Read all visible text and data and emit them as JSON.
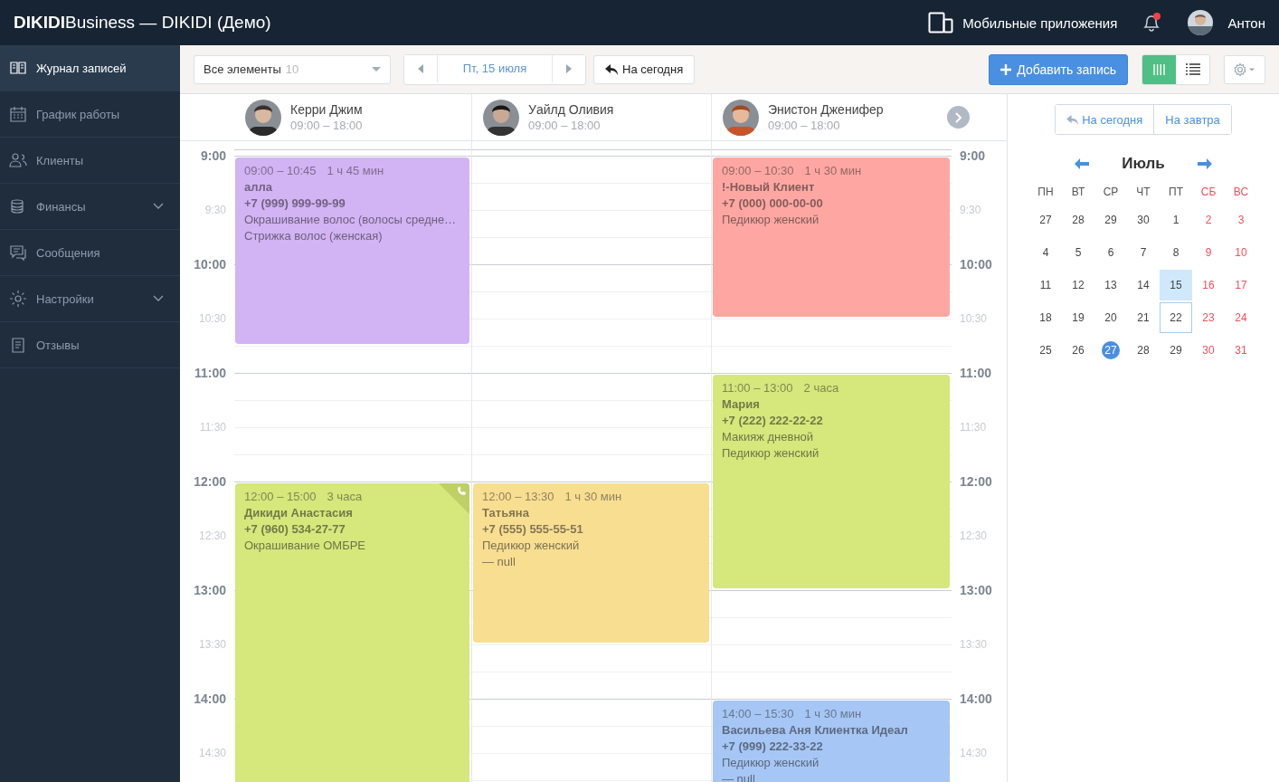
{
  "topbar": {
    "title": "**DIKIDI**Business —  DIKIDI (Демо)",
    "apps_link": "Мобильные приложения",
    "notifications": {
      "unread": true
    },
    "user": {
      "name": "Антон"
    }
  },
  "sidebar": {
    "items": [
      {
        "label": "Журнал записей",
        "selected": true,
        "submenu": false
      },
      {
        "label": "График работы",
        "selected": false,
        "submenu": false
      },
      {
        "label": "Клиенты",
        "selected": false,
        "submenu": false
      },
      {
        "label": "Финансы",
        "selected": false,
        "submenu": true
      },
      {
        "label": "Сообщения",
        "selected": false,
        "submenu": false
      },
      {
        "label": "Настройки",
        "selected": false,
        "submenu": true
      },
      {
        "label": "Отзывы",
        "selected": false,
        "submenu": false
      }
    ]
  },
  "toolbar": {
    "filter": {
      "label": "Все элементы",
      "count": "10"
    },
    "date": "Пт, 15 июля",
    "today_button": "На сегодня",
    "add_button": "Добавить запись",
    "views": [
      {
        "kind": "columns",
        "selected": true
      },
      {
        "kind": "list",
        "selected": false
      }
    ]
  },
  "time_rows": [
    {
      "kind": "hour",
      "left": "9:00",
      "right": "9:00"
    },
    {
      "kind": "half",
      "left": "9:30",
      "right": "9:30"
    },
    {
      "kind": "hour",
      "left": "10:00",
      "right": "10:00"
    },
    {
      "kind": "half",
      "left": "10:30",
      "right": "10:30"
    },
    {
      "kind": "hour",
      "left": "11:00",
      "right": "11:00"
    },
    {
      "kind": "half",
      "left": "11:30",
      "right": "11:30"
    },
    {
      "kind": "hour",
      "left": "12:00",
      "right": "12:00"
    },
    {
      "kind": "half",
      "left": "12:30",
      "right": "12:30"
    },
    {
      "kind": "hour",
      "left": "13:00",
      "right": "13:00"
    },
    {
      "kind": "half",
      "left": "13:30",
      "right": "13:30"
    },
    {
      "kind": "hour",
      "left": "14:00",
      "right": "14:00"
    },
    {
      "kind": "half",
      "left": "14:30",
      "right": "14:30"
    }
  ],
  "staff": [
    {
      "name": "Керри Джим",
      "hours": "09:00 – 18:00",
      "appointments": [
        {
          "time": "09:00 – 10:45",
          "duration": "1 ч 45 мин",
          "client": "алла",
          "phone": "+7 (999) 999-99-99",
          "services": [
            "Окрашивание волос (волосы средне…",
            "Стрижка волос (женская)"
          ],
          "color": "#d2b3f4",
          "phone_mark": false
        },
        {
          "time": "12:00 – 15:00",
          "duration": "3 часа",
          "client": "Дикиди Анастасия",
          "phone": "+7 (960) 534-27-77",
          "services": [
            "Окрашивание ОМБРЕ"
          ],
          "color": "#d6e77b",
          "phone_mark": true
        }
      ]
    },
    {
      "name": "Уайлд Оливия",
      "hours": "09:00 – 18:00",
      "appointments": [
        {
          "time": "12:00 – 13:30",
          "duration": "1 ч 30 мин",
          "client": "Татьяна",
          "phone": "+7 (555) 555-55-51",
          "services": [
            "Педикюр женский"
          ],
          "note": "— null",
          "color": "#f8de91",
          "phone_mark": false
        }
      ]
    },
    {
      "name": "Энистон Дженифер",
      "hours": "09:00 – 18:00",
      "appointments": [
        {
          "time": "09:00 – 10:30",
          "duration": "1 ч 30 мин",
          "client": "!-Новый Клиент",
          "phone": "+7 (000) 000-00-00",
          "services": [
            "Педикюр женский"
          ],
          "color": "#fea7a2",
          "phone_mark": false
        },
        {
          "time": "11:00 – 13:00",
          "duration": "2 часа",
          "client": "Мария",
          "phone": "+7 (222) 222-22-22",
          "services": [
            "Макияж дневной",
            "Педикюр женский"
          ],
          "color": "#d6e77b",
          "phone_mark": false
        },
        {
          "time": "14:00 – 15:30",
          "duration": "1 ч 30 мин",
          "client": "Васильева Аня Клиентка Идеал",
          "phone": "+7 (999) 222-33-22",
          "services": [
            "Педикюр женский"
          ],
          "note": "— null",
          "color": "#a6c6f5",
          "phone_mark": false
        }
      ]
    }
  ],
  "side_panel": {
    "today_button": "На сегодня",
    "tomorrow_button": "На завтра",
    "month": "Июль",
    "weekdays": [
      "ПН",
      "ВТ",
      "СР",
      "ЧТ",
      "ПТ",
      "СБ",
      "ВС"
    ],
    "weeks": [
      [
        {
          "day": "27",
          "selected": false,
          "today": false,
          "outlined": false
        },
        {
          "day": "28",
          "selected": false,
          "today": false,
          "outlined": false
        },
        {
          "day": "29",
          "selected": false,
          "today": false,
          "outlined": false
        },
        {
          "day": "30",
          "selected": false,
          "today": false,
          "outlined": false
        },
        {
          "day": "1",
          "selected": false,
          "today": false,
          "outlined": false
        },
        {
          "day": "2",
          "selected": false,
          "today": false,
          "outlined": false
        },
        {
          "day": "3",
          "selected": false,
          "today": false,
          "outlined": false
        }
      ],
      [
        {
          "day": "4",
          "selected": false,
          "today": false,
          "outlined": false
        },
        {
          "day": "5",
          "selected": false,
          "today": false,
          "outlined": false
        },
        {
          "day": "6",
          "selected": false,
          "today": false,
          "outlined": false
        },
        {
          "day": "7",
          "selected": false,
          "today": false,
          "outlined": false
        },
        {
          "day": "8",
          "selected": false,
          "today": false,
          "outlined": false
        },
        {
          "day": "9",
          "selected": false,
          "today": false,
          "outlined": false
        },
        {
          "day": "10",
          "selected": false,
          "today": false,
          "outlined": false
        }
      ],
      [
        {
          "day": "11",
          "selected": false,
          "today": false,
          "outlined": false
        },
        {
          "day": "12",
          "selected": false,
          "today": false,
          "outlined": false
        },
        {
          "day": "13",
          "selected": false,
          "today": false,
          "outlined": false
        },
        {
          "day": "14",
          "selected": false,
          "today": false,
          "outlined": false
        },
        {
          "day": "15",
          "selected": true,
          "today": false,
          "outlined": false
        },
        {
          "day": "16",
          "selected": false,
          "today": false,
          "outlined": false
        },
        {
          "day": "17",
          "selected": false,
          "today": false,
          "outlined": false
        }
      ],
      [
        {
          "day": "18",
          "selected": false,
          "today": false,
          "outlined": false
        },
        {
          "day": "19",
          "selected": false,
          "today": false,
          "outlined": false
        },
        {
          "day": "20",
          "selected": false,
          "today": false,
          "outlined": false
        },
        {
          "day": "21",
          "selected": false,
          "today": false,
          "outlined": false
        },
        {
          "day": "22",
          "selected": false,
          "today": false,
          "outlined": true
        },
        {
          "day": "23",
          "selected": false,
          "today": false,
          "outlined": false
        },
        {
          "day": "24",
          "selected": false,
          "today": false,
          "outlined": false
        }
      ],
      [
        {
          "day": "25",
          "selected": false,
          "today": false,
          "outlined": false
        },
        {
          "day": "26",
          "selected": false,
          "today": false,
          "outlined": false
        },
        {
          "day": "27",
          "selected": false,
          "today": true,
          "outlined": false
        },
        {
          "day": "28",
          "selected": false,
          "today": false,
          "outlined": false
        },
        {
          "day": "29",
          "selected": false,
          "today": false,
          "outlined": false
        },
        {
          "day": "30",
          "selected": false,
          "today": false,
          "outlined": false
        },
        {
          "day": "31",
          "selected": false,
          "today": false,
          "outlined": false
        }
      ]
    ]
  }
}
